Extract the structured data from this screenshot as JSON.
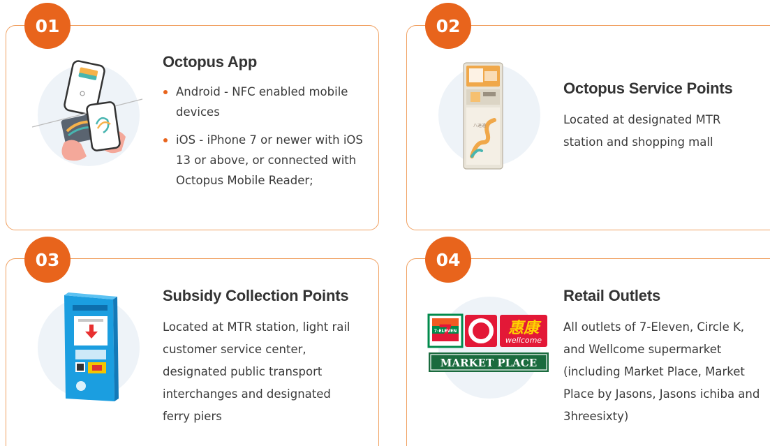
{
  "accent_color": "#e8641c",
  "border_color": "#f0a060",
  "cards": [
    {
      "number": "01",
      "title": "Octopus App",
      "icon": "octopus-app-icon",
      "bullets": [
        "Android - NFC enabled mobile devices",
        "iOS - iPhone 7 or newer with iOS 13 or above, or connected with Octopus Mobile Reader;"
      ]
    },
    {
      "number": "02",
      "title": "Octopus Service Points",
      "icon": "service-kiosk-icon",
      "description": "Located at designated MTR station and shopping mall"
    },
    {
      "number": "03",
      "title": "Subsidy Collection Points",
      "icon": "subsidy-machine-icon",
      "description": "Located at MTR station, light rail customer service center, designated public transport interchanges and designated ferry piers"
    },
    {
      "number": "04",
      "title": "Retail Outlets",
      "icon": "retail-logos-icon",
      "description": "All outlets of 7-Eleven, Circle K, and Wellcome supermarket (including Market Place, Market Place by Jasons, Jasons ichiba and 3hreesixty)",
      "logos": {
        "seven_eleven": "7-ELEVEN",
        "circle_k": "K",
        "wellcome_chinese": "惠康",
        "wellcome": "wellcome",
        "market_place": "MARKET PLACE"
      }
    }
  ]
}
